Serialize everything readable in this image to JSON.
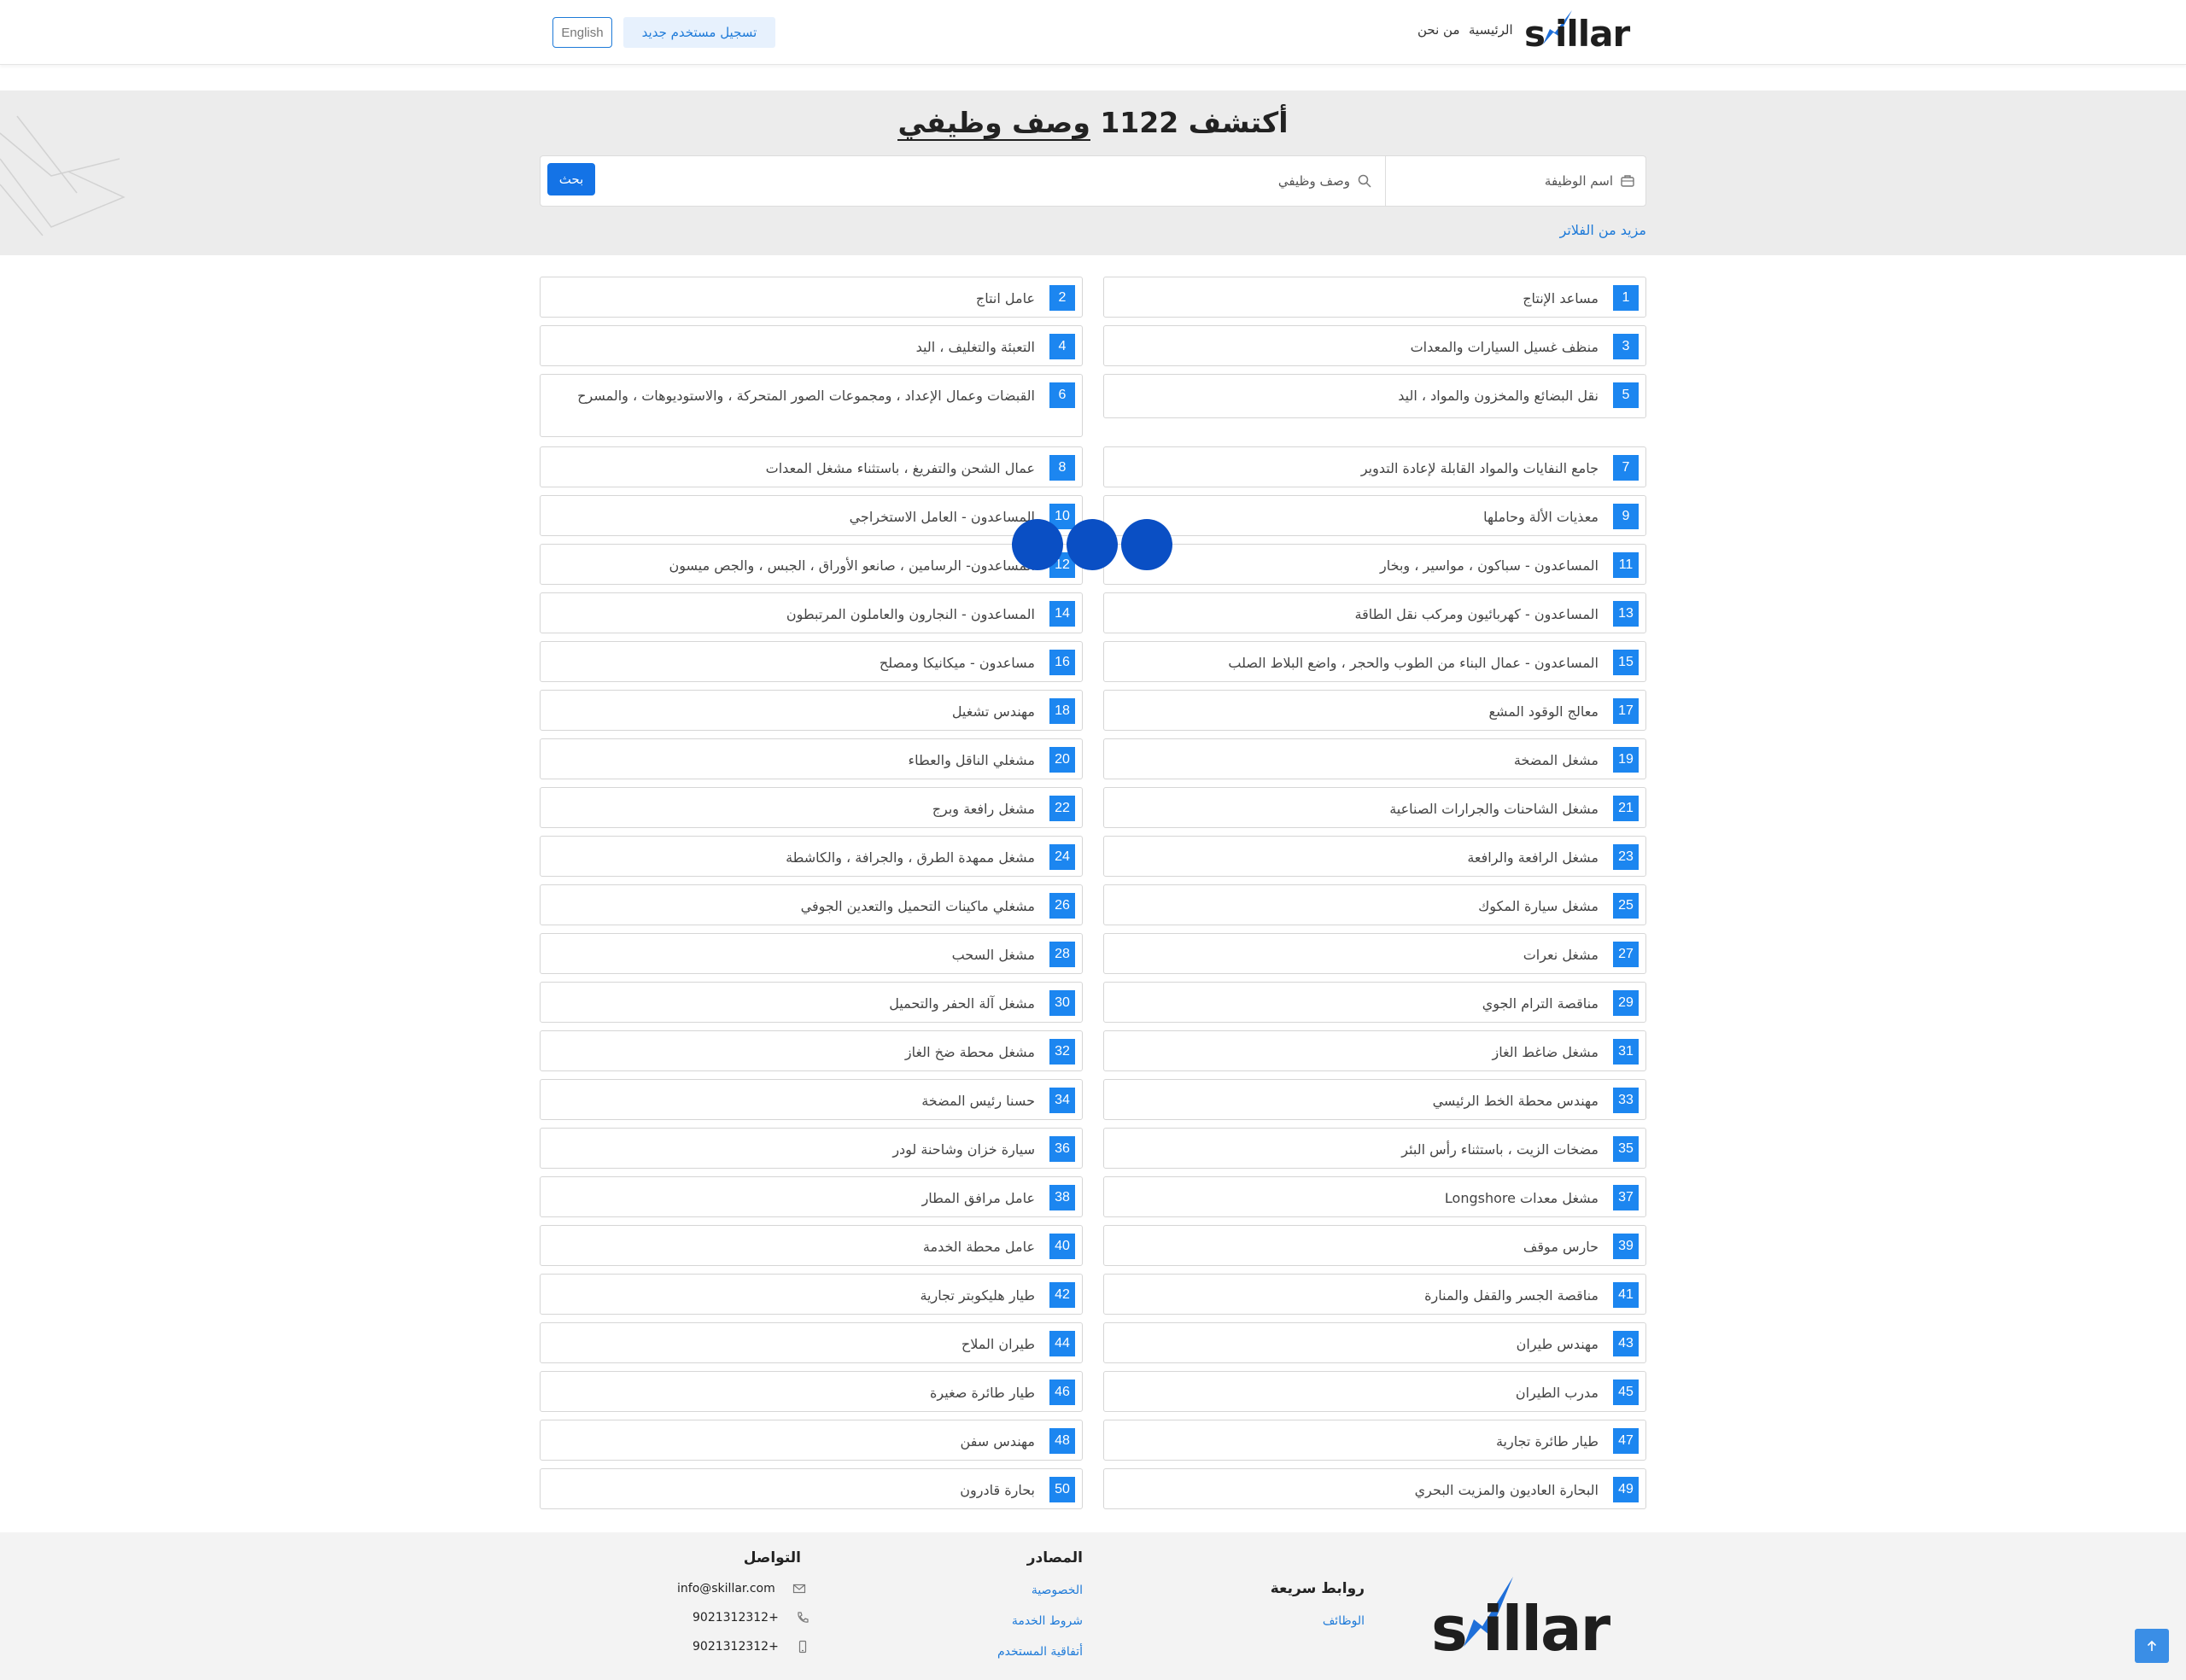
{
  "header": {
    "nav_home": "الرئيسية",
    "nav_about": "من نحن",
    "register_label": "تسجيل مستخدم جديد",
    "lang_label": "English",
    "logo_text": "skillar"
  },
  "hero": {
    "title_prefix": "أكتشف ",
    "title_count": "1122",
    "title_suffix": "وصف وظيفي",
    "job_placeholder": "اسم الوظيفة",
    "desc_placeholder": "وصف وظيفي",
    "search_label": "بحث",
    "more_filters": "مزيد من الفلاتر"
  },
  "jobs": [
    {
      "n": "1",
      "t": "مساعد الإنتاج"
    },
    {
      "n": "2",
      "t": "عامل انتاج"
    },
    {
      "n": "3",
      "t": "منظف غسيل السيارات والمعدات"
    },
    {
      "n": "4",
      "t": "التعبئة والتغليف ، اليد"
    },
    {
      "n": "5",
      "t": "نقل البضائع والمخزون والمواد ، اليد"
    },
    {
      "n": "6",
      "t": "القبضات وعمال الإعداد ، ومجموعات الصور المتحركة ، والاستوديوهات ، والمسرح"
    },
    {
      "n": "7",
      "t": "جامع النفايات والمواد القابلة لإعادة التدوير"
    },
    {
      "n": "8",
      "t": "عمال الشحن والتفريغ ، باستثناء مشغل المعدات"
    },
    {
      "n": "9",
      "t": "معذيات الألة وحاملها"
    },
    {
      "n": "10",
      "t": "المساعدون - العامل الاستخراجي"
    },
    {
      "n": "11",
      "t": "المساعدون - سباكون ، مواسير ، وبخار"
    },
    {
      "n": "12",
      "t": "المساعدون- الرسامين ، صانعو الأوراق ، الجبس ، والجص ميسون"
    },
    {
      "n": "13",
      "t": "المساعدون - كهربائيون ومركب نقل الطاقة"
    },
    {
      "n": "14",
      "t": "المساعدون - النجارون والعاملون المرتبطون"
    },
    {
      "n": "15",
      "t": "المساعدون - عمال البناء من الطوب والحجر ، واضع البلاط الصلب"
    },
    {
      "n": "16",
      "t": "مساعدون - ميكانيكا ومصلح"
    },
    {
      "n": "17",
      "t": "معالج الوقود المشع"
    },
    {
      "n": "18",
      "t": "مهندس تشغيل"
    },
    {
      "n": "19",
      "t": "مشغل المضخة"
    },
    {
      "n": "20",
      "t": "مشغلي الناقل والعطاء"
    },
    {
      "n": "21",
      "t": "مشغل الشاحنات والجرارات الصناعية"
    },
    {
      "n": "22",
      "t": "مشغل رافعة وبرج"
    },
    {
      "n": "23",
      "t": "مشغل الرافعة والرافعة"
    },
    {
      "n": "24",
      "t": "مشغل ممهدة الطرق ، والجرافة ، والكاشطة"
    },
    {
      "n": "25",
      "t": "مشغل سيارة المكوك"
    },
    {
      "n": "26",
      "t": "مشغلي ماكينات التحميل والتعدين الجوفي"
    },
    {
      "n": "27",
      "t": "مشغل نعرات"
    },
    {
      "n": "28",
      "t": "مشغل السحب"
    },
    {
      "n": "29",
      "t": "مناقصة الترام الجوي"
    },
    {
      "n": "30",
      "t": "مشغل آلة الحفر والتحميل"
    },
    {
      "n": "31",
      "t": "مشغل ضاغط الغاز"
    },
    {
      "n": "32",
      "t": "مشغل محطة ضخ الغاز"
    },
    {
      "n": "33",
      "t": "مهندس محطة الخط الرئيسي"
    },
    {
      "n": "34",
      "t": "حسنا رئيس المضخة"
    },
    {
      "n": "35",
      "t": "مضخات الزيت ، باستثناء رأس البئر"
    },
    {
      "n": "36",
      "t": "سيارة خزان وشاحنة لودر"
    },
    {
      "n": "37",
      "t": "مشغل معدات Longshore"
    },
    {
      "n": "38",
      "t": "عامل مرافق المطار"
    },
    {
      "n": "39",
      "t": "حارس موقف"
    },
    {
      "n": "40",
      "t": "عامل محطة الخدمة"
    },
    {
      "n": "41",
      "t": "مناقصة الجسر والقفل والمنارة"
    },
    {
      "n": "42",
      "t": "طيار هليكوبتر تجارية"
    },
    {
      "n": "43",
      "t": "مهندس طيران"
    },
    {
      "n": "44",
      "t": "طيران الملاح"
    },
    {
      "n": "45",
      "t": "مدرب الطيران"
    },
    {
      "n": "46",
      "t": "طيار طائرة صغيرة"
    },
    {
      "n": "47",
      "t": "طيار طائرة تجارية"
    },
    {
      "n": "48",
      "t": "مهندس سفن"
    },
    {
      "n": "49",
      "t": "البحارة العاديون والمزيت البحري"
    },
    {
      "n": "50",
      "t": "بحارة قادرون"
    }
  ],
  "footer": {
    "quick_links_title": "روابط سريعة",
    "quick_links": [
      "الوظائف"
    ],
    "resources_title": "المصادر",
    "resources": [
      "الخصوصية",
      "شروط الخدمة",
      "أتفاقية المستخدم"
    ],
    "contact_title": "التواصل",
    "email": "info@skillar.com",
    "phone": "9021312312+",
    "mobile": "9021312312+",
    "logo_text": "skillar"
  },
  "colors": {
    "accent": "#1c86f0",
    "link": "#1e7ad8",
    "loader": "#0a4fc4"
  },
  "icons": [
    "briefcase-icon",
    "search-icon",
    "mail-icon",
    "phone-icon",
    "mobile-icon",
    "arrow-up-icon"
  ]
}
